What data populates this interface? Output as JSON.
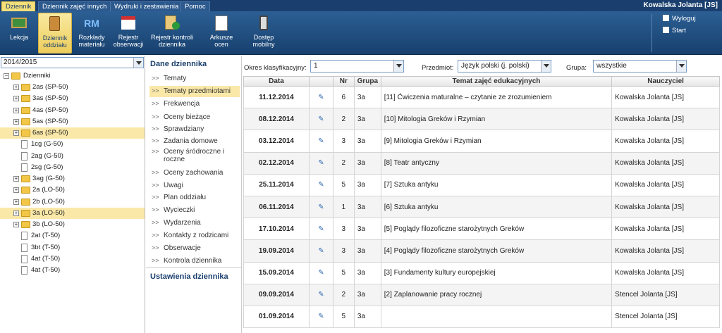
{
  "menu": {
    "tabs": [
      "Dziennik",
      "Dziennik zajęć innych",
      "Wydruki i zestawienia",
      "Pomoc"
    ],
    "user": "Kowalska Jolanta [JS]"
  },
  "toolbar": {
    "items": [
      {
        "label": "Lekcja"
      },
      {
        "label": "Dziennik oddziału"
      },
      {
        "label": "Rozkłady materiału",
        "icon_text": "RM"
      },
      {
        "label": "Rejestr obserwacji"
      },
      {
        "label": "Rejestr kontroli dziennika"
      },
      {
        "label": "Arkusze ocen"
      },
      {
        "label": "Dostęp mobilny"
      }
    ],
    "logout": "Wyloguj",
    "start": "Start"
  },
  "left": {
    "year": "2014/2015",
    "root": "Dzienniki",
    "items": [
      "2as (SP-50)",
      "3as (SP-50)",
      "4as (SP-50)",
      "5as (SP-50)",
      "6as (SP-50)",
      "1cg (G-50)",
      "2ag (G-50)",
      "2sg (G-50)",
      "3ag (G-50)",
      "2a (LO-50)",
      "2b (LO-50)",
      "3a (LO-50)",
      "3b (LO-50)",
      "2at (T-50)",
      "3bt (T-50)",
      "4at (T-50)",
      "4at (T-50)"
    ]
  },
  "middle": {
    "header": "Dane dziennika",
    "items": [
      "Tematy",
      "Tematy przedmiotami",
      "Frekwencja",
      "Oceny bieżące",
      "Sprawdziany",
      "Zadania domowe",
      "Oceny śródroczne i roczne",
      "Oceny zachowania",
      "Uwagi",
      "Plan oddziału",
      "Wycieczki",
      "Wydarzenia",
      "Kontakty z rodzicami",
      "Obserwacje",
      "Kontrola dziennika"
    ],
    "footer": "Ustawienia dziennika"
  },
  "filters": {
    "period_label": "Okres klasyfikacyjny:",
    "period": "1",
    "subject_label": "Przedmiot:",
    "subject": "Język polski (j. polski)",
    "group_label": "Grupa:",
    "group": "wszystkie"
  },
  "table": {
    "headers": [
      "Data",
      "",
      "Nr",
      "Grupa",
      "Temat zajęć edukacyjnych",
      "Nauczyciel"
    ],
    "rows": [
      [
        "11.12.2014",
        "6",
        "3a",
        "[11] Ćwiczenia maturalne – czytanie ze zrozumieniem",
        "Kowalska Jolanta [JS]"
      ],
      [
        "08.12.2014",
        "2",
        "3a",
        "[10] Mitologia Greków i Rzymian",
        "Kowalska Jolanta [JS]"
      ],
      [
        "03.12.2014",
        "3",
        "3a",
        "[9] Mitologia Greków i Rzymian",
        "Kowalska Jolanta [JS]"
      ],
      [
        "02.12.2014",
        "2",
        "3a",
        "[8] Teatr antyczny",
        "Kowalska Jolanta [JS]"
      ],
      [
        "25.11.2014",
        "5",
        "3a",
        "[7] Sztuka antyku",
        "Kowalska Jolanta [JS]"
      ],
      [
        "06.11.2014",
        "1",
        "3a",
        "[6] Sztuka antyku",
        "Kowalska Jolanta [JS]"
      ],
      [
        "17.10.2014",
        "3",
        "3a",
        "[5] Poglądy filozoficzne starożytnych Greków",
        "Kowalska Jolanta [JS]"
      ],
      [
        "19.09.2014",
        "3",
        "3a",
        "[4] Poglądy filozoficzne starożytnych Greków",
        "Kowalska Jolanta [JS]"
      ],
      [
        "15.09.2014",
        "5",
        "3a",
        "[3] Fundamenty kultury europejskiej",
        "Kowalska Jolanta [JS]"
      ],
      [
        "09.09.2014",
        "2",
        "3a",
        "[2] Zaplanowanie pracy rocznej",
        "Stencel Jolanta [JS]"
      ],
      [
        "01.09.2014",
        "5",
        "3a",
        "",
        "Stencel Jolanta [JS]"
      ]
    ]
  }
}
